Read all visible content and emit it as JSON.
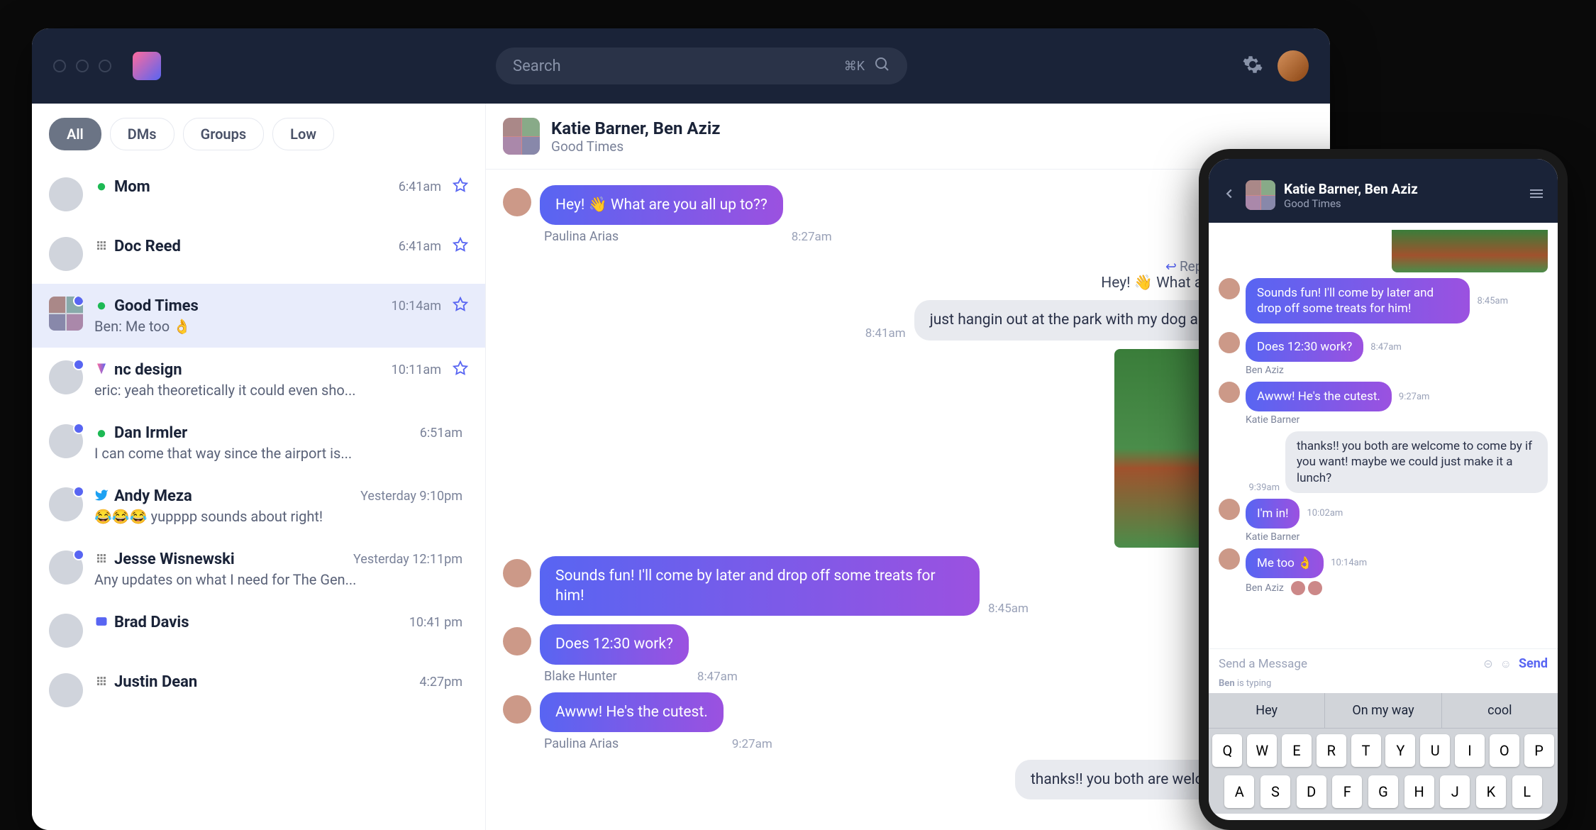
{
  "search": {
    "placeholder": "Search",
    "shortcut": "⌘K"
  },
  "filters": [
    "All",
    "DMs",
    "Groups",
    "Low"
  ],
  "active_filter": 0,
  "conversations": [
    {
      "name": "Mom",
      "time": "6:41am",
      "network": "green",
      "starred": true,
      "preview": "",
      "unread": false
    },
    {
      "name": "Doc Reed",
      "time": "6:41am",
      "network": "slack",
      "starred": true,
      "preview": "",
      "unread": false
    },
    {
      "name": "Good Times",
      "time": "10:14am",
      "network": "green",
      "starred": true,
      "preview": "Ben: Me too 👌",
      "unread": true,
      "multi": true,
      "selected": true
    },
    {
      "name": "nc design",
      "time": "10:11am",
      "network": "beeper",
      "starred": true,
      "preview": "eric: yeah theoretically it could even sho...",
      "unread": true
    },
    {
      "name": "Dan Irmler",
      "time": "6:51am",
      "network": "green",
      "starred": false,
      "preview": "I can come that way since the airport is...",
      "unread": true
    },
    {
      "name": "Andy Meza",
      "time": "Yesterday 9:10pm",
      "network": "twitter",
      "starred": false,
      "preview": "😂😂😂 yupppp sounds about right!",
      "unread": true
    },
    {
      "name": "Jesse Wisnewski",
      "time": "Yesterday 12:11pm",
      "network": "slack",
      "starred": false,
      "preview": "Any updates on what I need for The Gen...",
      "unread": true
    },
    {
      "name": "Brad Davis",
      "time": "10:41 pm",
      "network": "discord",
      "starred": false,
      "preview": "",
      "unread": false
    },
    {
      "name": "Justin Dean",
      "time": "4:27pm",
      "network": "slack",
      "starred": false,
      "preview": "",
      "unread": false
    }
  ],
  "chat": {
    "title": "Katie Barner, Ben Aziz",
    "subtitle": "Good Times",
    "messages": [
      {
        "type": "sent",
        "text": "Hey! 👋 What are you all up to??",
        "time": "8:27am",
        "sender": "Paulina Arias"
      },
      {
        "type": "reply_ctx",
        "label": "Reply to Paulina Arias:",
        "quote": "Hey! 👋 What are you all up to??"
      },
      {
        "type": "recv",
        "text": "just hangin out at the park with my dog about you guys?",
        "time": "8:41am"
      },
      {
        "type": "recv_image",
        "time": ""
      },
      {
        "type": "sent",
        "text": "Sounds fun! I'll come by later and drop off some treats for him!",
        "time": "8:45am",
        "sender": ""
      },
      {
        "type": "sent",
        "text": "Does 12:30 work?",
        "time": "8:47am",
        "sender": "Blake Hunter"
      },
      {
        "type": "sent",
        "text": "Awww! He's the cutest.",
        "time": "9:27am",
        "sender": "Paulina Arias"
      },
      {
        "type": "recv",
        "text": "thanks!! you both are welcome to come l",
        "time": ""
      }
    ]
  },
  "mobile": {
    "title": "Katie Barner, Ben Aziz",
    "subtitle": "Good Times",
    "messages": [
      {
        "type": "sent",
        "text": "Sounds fun! I'll come by later and drop off some treats for him!",
        "time": "8:45am",
        "sender": ""
      },
      {
        "type": "sent",
        "text": "Does 12:30 work?",
        "time": "8:47am",
        "sender": "Ben Aziz"
      },
      {
        "type": "sent",
        "text": "Awww! He's the cutest.",
        "time": "9:27am",
        "sender": "Katie Barner"
      },
      {
        "type": "recv",
        "text": "thanks!! you both are welcome to come by if you want! maybe we could just make it a lunch?",
        "time": "9:39am"
      },
      {
        "type": "sent",
        "text": "I'm in!",
        "time": "10:02am",
        "sender": "Katie Barner"
      },
      {
        "type": "sent",
        "text": "Me too 👌",
        "time": "10:14am",
        "sender": "Ben Aziz",
        "reactions": 2
      }
    ],
    "compose_placeholder": "Send a Message",
    "send_label": "Send",
    "typing": "Ben is typing",
    "suggestions": [
      "Hey",
      "On my way",
      "cool"
    ],
    "keys_row1": [
      "Q",
      "W",
      "E",
      "R",
      "T",
      "Y",
      "U",
      "I",
      "O",
      "P"
    ],
    "keys_row2": [
      "A",
      "S",
      "D",
      "F",
      "G",
      "H",
      "J",
      "K",
      "L"
    ]
  }
}
